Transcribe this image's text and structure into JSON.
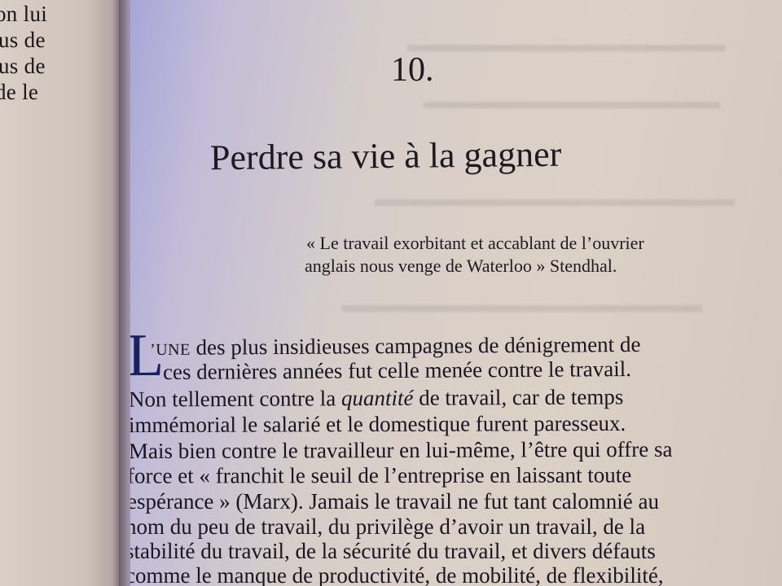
{
  "left_page": {
    "lines": [
      "on lui",
      "us de",
      "us de",
      "de le"
    ]
  },
  "chapter": {
    "number": "10.",
    "title": "Perdre sa vie à la gagner"
  },
  "epigraph": {
    "line1": "« Le travail exorbitant et accablant de l’ouvrier",
    "line2": "anglais nous venge de Waterloo » Stendhal."
  },
  "body": {
    "drop_cap": "L",
    "line1_smallcaps": "’UNE",
    "line1_rest": " des plus insidieuses campagnes de dénigrement de",
    "line2": "ces dernières années fut celle menée contre le travail.",
    "line3_start": "Non tellement contre la ",
    "line3_italic": "quantité",
    "line3_end": " de travail, car de temps",
    "line4": "immémorial le salarié et le domestique furent paresseux.",
    "line5": "Mais bien contre le travailleur en lui-même, l’être qui offre sa",
    "line6": "force et « franchit le seuil de l’entreprise en laissant toute",
    "line7": "espérance » (Marx). Jamais le travail ne fut tant calomnié au",
    "line8": "nom du peu de travail, du privilège d’avoir un travail, de la",
    "line9": "stabilité du travail, de la sécurité du travail, et divers défauts",
    "line10": "comme le manque de productivité, de mobilité, de flexibilité,"
  }
}
